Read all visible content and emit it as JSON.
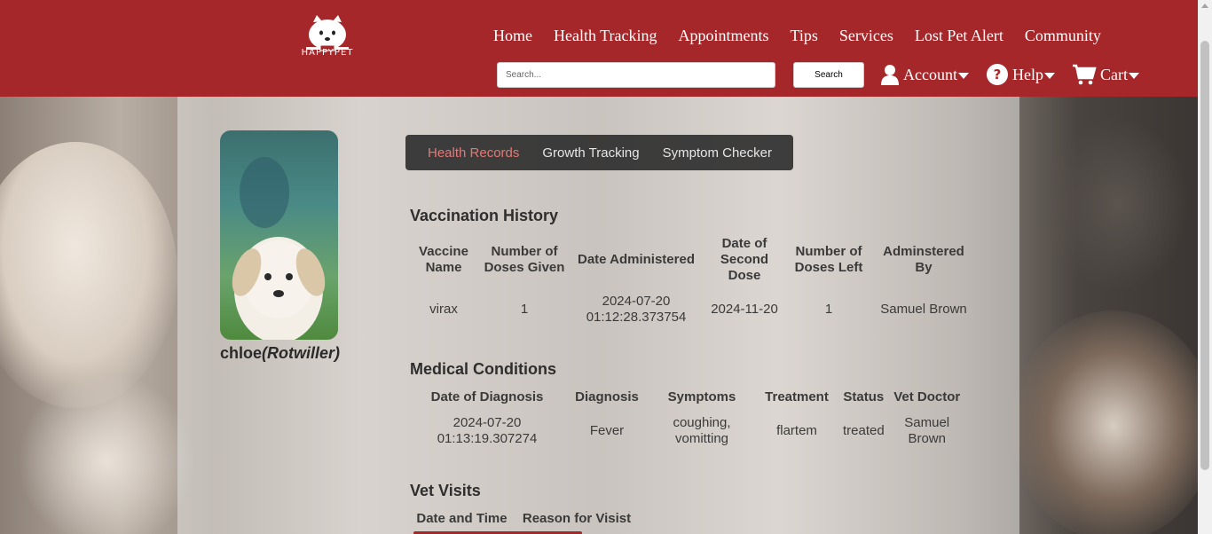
{
  "brand": {
    "name": "HAPPYPET"
  },
  "nav": {
    "items": [
      "Home",
      "Health Tracking",
      "Appointments",
      "Tips",
      "Services",
      "Lost Pet Alert",
      "Community"
    ]
  },
  "search": {
    "placeholder": "Search...",
    "button": "Search"
  },
  "menus": {
    "account": "Account",
    "help": "Help",
    "cart": "Cart"
  },
  "pet": {
    "name": "chloe",
    "breed": "(Rotwiller)"
  },
  "tabs": [
    {
      "label": "Health Records",
      "active": true
    },
    {
      "label": "Growth Tracking",
      "active": false
    },
    {
      "label": "Symptom Checker",
      "active": false
    }
  ],
  "vaccination": {
    "title": "Vaccination History",
    "headers": [
      "Vaccine Name",
      "Number of Doses Given",
      "Date Administered",
      "Date of Second Dose",
      "Number of Doses Left",
      "Adminstered By"
    ],
    "rows": [
      [
        "virax",
        "1",
        "2024-07-20 01:12:28.373754",
        "2024-11-20",
        "1",
        "Samuel Brown"
      ]
    ]
  },
  "conditions": {
    "title": "Medical Conditions",
    "headers": [
      "Date of Diagnosis",
      "Diagnosis",
      "Symptoms",
      "Treatment",
      "Status",
      "Vet Doctor"
    ],
    "rows": [
      [
        "2024-07-20 01:13:19.307274",
        "Fever",
        "coughing, vomitting",
        "flartem",
        "treated",
        "Samuel Brown"
      ]
    ]
  },
  "visits": {
    "title": "Vet Visits",
    "headers": [
      "Date and Time",
      "Reason for Visist"
    ]
  },
  "colors": {
    "header": "#a6272a",
    "active_tab": "#e07a78"
  }
}
